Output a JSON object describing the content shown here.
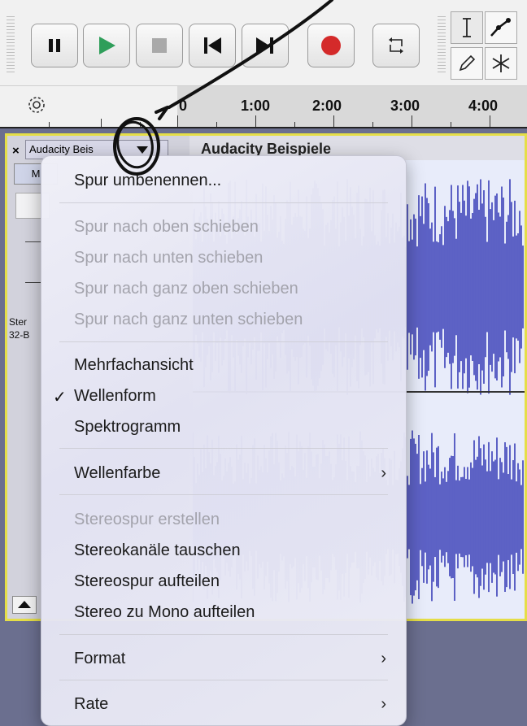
{
  "toolbar": {
    "buttons": [
      {
        "name": "pause",
        "icon": "pause-icon"
      },
      {
        "name": "play",
        "icon": "play-icon"
      },
      {
        "name": "stop",
        "icon": "stop-icon"
      },
      {
        "name": "skip-start",
        "icon": "skip-to-start-icon"
      },
      {
        "name": "skip-end",
        "icon": "skip-to-end-icon"
      },
      {
        "name": "record",
        "icon": "record-icon"
      },
      {
        "name": "loop",
        "icon": "loop-icon"
      }
    ],
    "tools": [
      "selection-tool-icon",
      "envelope-tool-icon",
      "draw-tool-icon",
      "multi-tool-icon"
    ],
    "colors": {
      "play": "#2f9e5a",
      "record": "#d42a2a"
    }
  },
  "timeline": {
    "labels": [
      "0",
      "1:00",
      "2:00",
      "3:00",
      "4:00"
    ]
  },
  "track": {
    "close": "×",
    "name": "Audacity Beis",
    "title": "Audacity Beispiele",
    "mute": "M",
    "info_line1": "Ster",
    "info_line2": "32-B",
    "wave_color": "#3a3fb8"
  },
  "menu": {
    "rename": "Spur umbenennen...",
    "move_up": "Spur nach oben schieben",
    "move_down": "Spur nach unten schieben",
    "move_top": "Spur nach ganz oben schieben",
    "move_bottom": "Spur nach ganz unten schieben",
    "multi_view": "Mehrfachansicht",
    "check_mark": "✓",
    "waveform": "Wellenform",
    "spectrogram": "Spektrogramm",
    "wave_color": "Wellenfarbe",
    "make_stereo": "Stereospur erstellen",
    "swap_channels": "Stereokanäle tauschen",
    "split_stereo": "Stereospur aufteilen",
    "split_mono": "Stereo zu Mono aufteilen",
    "format": "Format",
    "rate": "Rate",
    "submenu_arrow": "›"
  }
}
